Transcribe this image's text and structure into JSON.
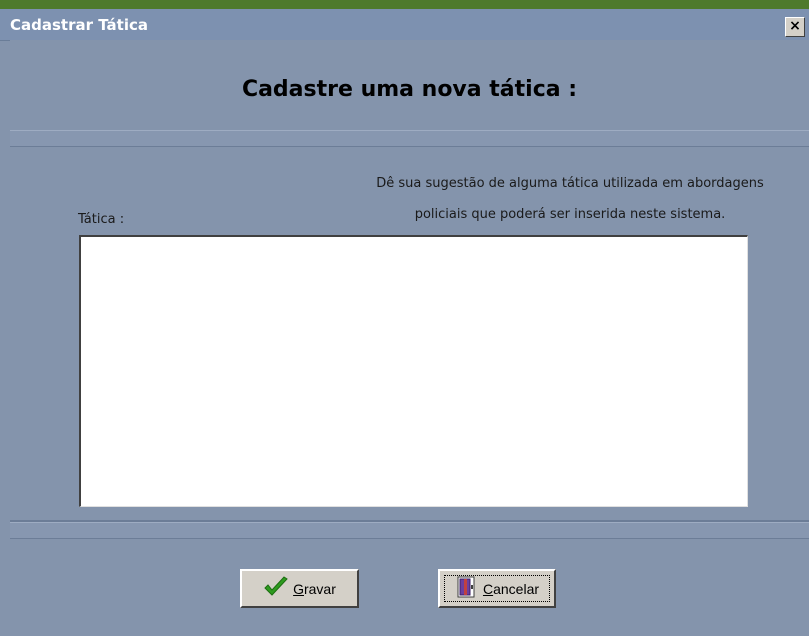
{
  "window": {
    "title": "Cadastrar Tática",
    "close_glyph": "×"
  },
  "header": {
    "heading": "Cadastre uma nova tática :"
  },
  "form": {
    "hint_line1": "Dê sua sugestão de alguma tática utilizada em abordagens",
    "hint_line2": "policiais que poderá ser inserida neste sistema.",
    "field_label": "Tática :",
    "field_value": ""
  },
  "footer": {
    "save_label_underlined": "G",
    "save_label_rest": "ravar",
    "save_icon": "check-icon",
    "cancel_label_underlined": "C",
    "cancel_label_rest": "ancelar",
    "cancel_icon": "door-icon"
  },
  "colors": {
    "window_bg": "#8494ac",
    "titlebar": "#7d91b0",
    "button_face": "#d4d0c8",
    "check_green": "#2e9b1f"
  }
}
